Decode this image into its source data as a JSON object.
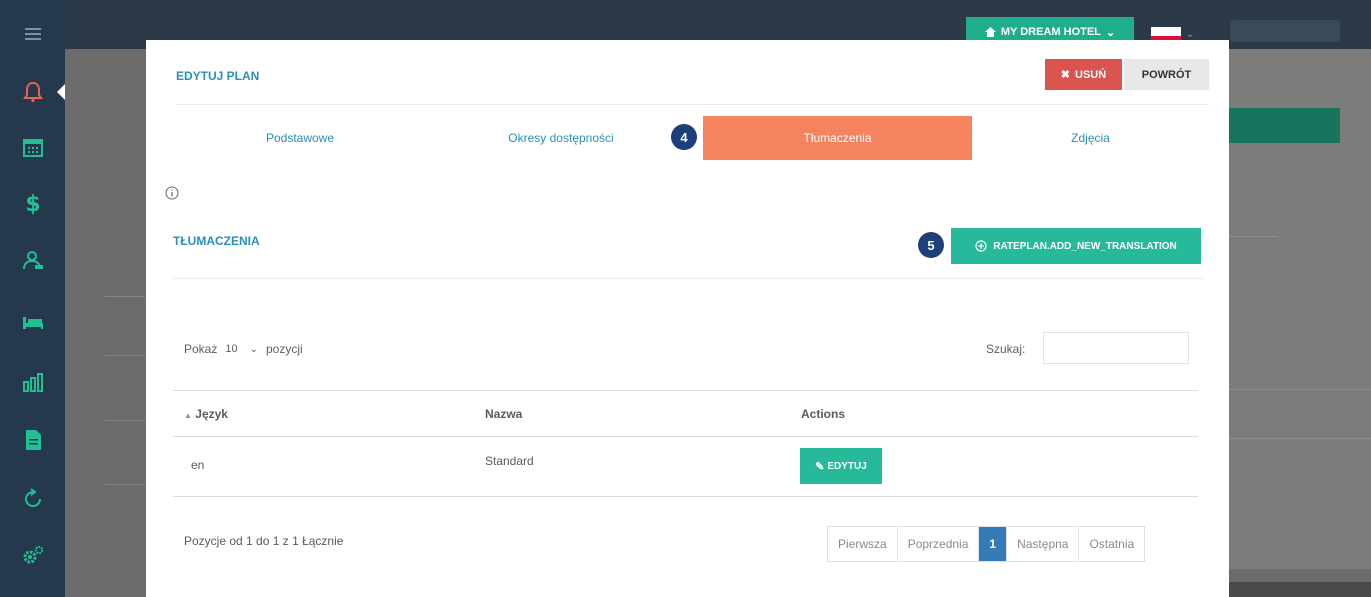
{
  "topbar": {
    "hotel_button": "MY DREAM HOTEL",
    "flag": "polish-flag"
  },
  "sidebar": {
    "items": [
      {
        "icon": "menu-icon"
      },
      {
        "icon": "bell-icon"
      },
      {
        "icon": "calendar-icon"
      },
      {
        "icon": "dollar-icon"
      },
      {
        "icon": "user-icon"
      },
      {
        "icon": "bed-icon"
      },
      {
        "icon": "chart-icon"
      },
      {
        "icon": "document-icon"
      },
      {
        "icon": "refresh-icon"
      },
      {
        "icon": "gears-icon"
      }
    ]
  },
  "modal": {
    "title": "EDYTUJ PLAN",
    "delete_label": "USUŃ",
    "back_label": "POWRÓT",
    "tabs": [
      {
        "label": "Podstawowe"
      },
      {
        "label": "Okresy dostępności"
      },
      {
        "label": "Tłumaczenia"
      },
      {
        "label": "Zdjęcia"
      }
    ],
    "step_badges": [
      "4",
      "5"
    ],
    "section_title": "TŁUMACZENIA",
    "add_button": "RATEPLAN.ADD_NEW_TRANSLATION",
    "show_prefix": "Pokaż",
    "show_value": "10",
    "show_suffix": "pozycji",
    "search_label": "Szukaj:",
    "table": {
      "columns": [
        "Język",
        "Nazwa",
        "Actions"
      ],
      "rows": [
        {
          "language": "en",
          "name": "Standard",
          "action": "EDYTUJ"
        }
      ]
    },
    "info_text": "Pozycje od 1 do 1 z 1 Łącznie",
    "pagination": [
      "Pierwsza",
      "Poprzednia",
      "1",
      "Następna",
      "Ostatnia"
    ]
  },
  "colors": {
    "accent_green": "#26b99a",
    "active_tab": "#f4845f",
    "delete_red": "#d9534f",
    "title_blue": "#2a8fbd",
    "sidebar_bg": "#24394d",
    "badge_navy": "#1d3f7a",
    "page_active": "#337ab7"
  }
}
